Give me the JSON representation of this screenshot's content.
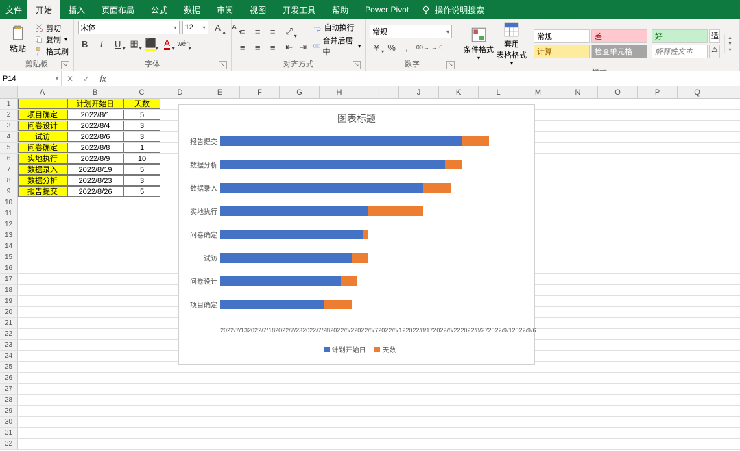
{
  "titlebar": {
    "file": "文件",
    "tabs": [
      "开始",
      "插入",
      "页面布局",
      "公式",
      "数据",
      "审阅",
      "视图",
      "开发工具",
      "帮助",
      "Power Pivot"
    ],
    "active_tab": 0,
    "search_hint": "操作说明搜索"
  },
  "ribbon": {
    "clipboard": {
      "label": "剪贴板",
      "paste": "粘贴",
      "cut": "剪切",
      "copy": "复制",
      "format_painter": "格式刷"
    },
    "font": {
      "label": "字体",
      "name": "宋体",
      "size": "12"
    },
    "align": {
      "label": "对齐方式",
      "wrap": "自动换行",
      "merge": "合并后居中"
    },
    "number": {
      "label": "数字",
      "format": "常规"
    },
    "styles": {
      "label": "样式",
      "cond": "条件格式",
      "table": "套用\n表格格式",
      "normal": "常规",
      "bad": "差",
      "good": "好",
      "calc": "计算",
      "check": "检查单元格",
      "explain": "解释性文本",
      "suitable": "适"
    }
  },
  "fbar": {
    "ref": "P14",
    "formula": ""
  },
  "columns": [
    "A",
    "B",
    "C",
    "D",
    "E",
    "F",
    "G",
    "H",
    "I",
    "J",
    "K",
    "L",
    "M",
    "N",
    "O",
    "P",
    "Q"
  ],
  "table": {
    "headers": [
      "",
      "计划开始日",
      "天数"
    ],
    "rows": [
      {
        "task": "项目确定",
        "date": "2022/8/1",
        "days": "5"
      },
      {
        "task": "问卷设计",
        "date": "2022/8/4",
        "days": "3"
      },
      {
        "task": "试访",
        "date": "2022/8/6",
        "days": "3"
      },
      {
        "task": "问卷确定",
        "date": "2022/8/8",
        "days": "1"
      },
      {
        "task": "实地执行",
        "date": "2022/8/9",
        "days": "10"
      },
      {
        "task": "数据录入",
        "date": "2022/8/19",
        "days": "5"
      },
      {
        "task": "数据分析",
        "date": "2022/8/23",
        "days": "3"
      },
      {
        "task": "报告提交",
        "date": "2022/8/26",
        "days": "5"
      }
    ]
  },
  "chart_data": {
    "type": "bar",
    "title": "图表标题",
    "ylabel_categories": [
      "报告提交",
      "数据分析",
      "数据录入",
      "实地执行",
      "问卷确定",
      "试访",
      "问卷设计",
      "项目确定"
    ],
    "x_ticks": [
      "2022/7/13",
      "2022/7/18",
      "2022/7/23",
      "2022/7/28",
      "2022/8/2",
      "2022/8/7",
      "2022/8/12",
      "2022/8/17",
      "2022/8/22",
      "2022/8/27",
      "2022/9/1",
      "2022/9/6"
    ],
    "x_min_serial": 44755,
    "x_max_serial": 44810,
    "series": [
      {
        "name": "计划开始日",
        "color": "#4472c4",
        "values_serial": [
          44799,
          44796,
          44792,
          44782,
          44781,
          44779,
          44777,
          44774
        ]
      },
      {
        "name": "天数",
        "color": "#ed7d31",
        "values": [
          5,
          3,
          5,
          10,
          1,
          3,
          3,
          5
        ]
      }
    ],
    "legend": [
      "计划开始日",
      "天数"
    ]
  }
}
